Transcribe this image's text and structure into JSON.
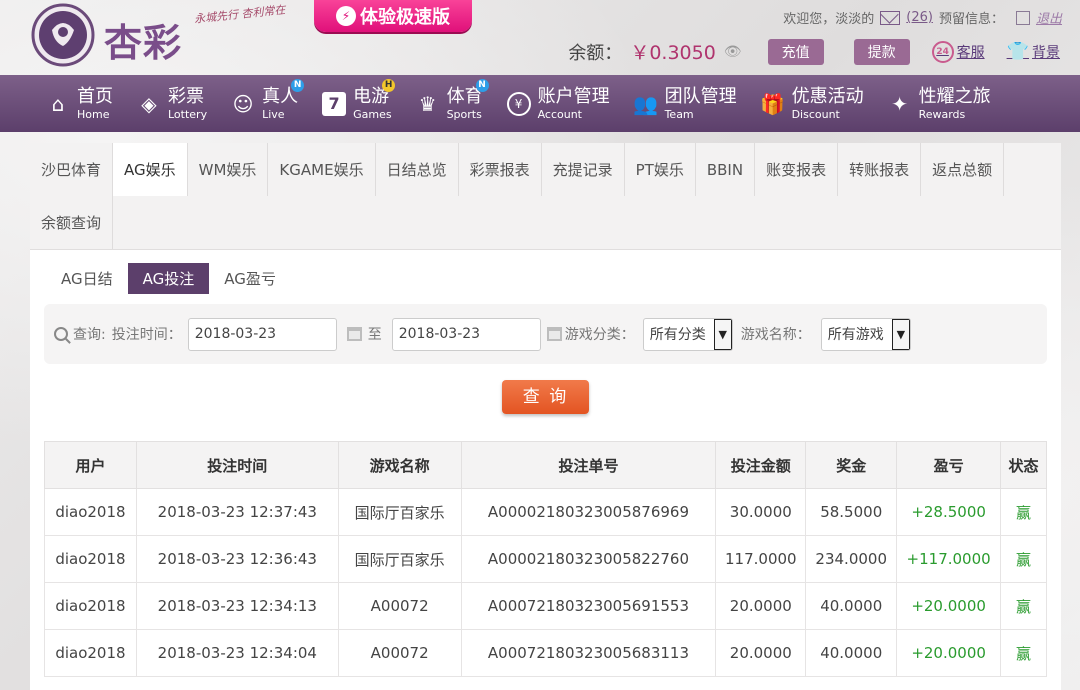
{
  "header": {
    "logo_text": "杏彩",
    "slogan": "永城先行 杏利常在",
    "promo_label": "体验极速版",
    "welcome": "欢迎您，",
    "username": "淡淡的",
    "mail_count": "(26)",
    "alert_label": "预留信息：",
    "logout_label": "退出",
    "balance_label": "余额：",
    "balance_value": "￥0.3050",
    "deposit_label": "充值",
    "withdraw_label": "提款",
    "service_label": "客服",
    "service_badge": "24",
    "theme_label": "背景"
  },
  "nav": [
    {
      "cn": "首页",
      "en": "Home",
      "icon": "home-icon",
      "badge": ""
    },
    {
      "cn": "彩票",
      "en": "Lottery",
      "icon": "ticket-icon",
      "badge": ""
    },
    {
      "cn": "真人",
      "en": "Live",
      "icon": "dealer-icon",
      "badge": "N"
    },
    {
      "cn": "电游",
      "en": "Games",
      "icon": "slot-seven-icon",
      "badge": "H"
    },
    {
      "cn": "体育",
      "en": "Sports",
      "icon": "trophy-icon",
      "badge": "N"
    },
    {
      "cn": "账户管理",
      "en": "Account",
      "icon": "yen-coin-icon",
      "badge": ""
    },
    {
      "cn": "团队管理",
      "en": "Team",
      "icon": "team-icon",
      "badge": ""
    },
    {
      "cn": "优惠活动",
      "en": "Discount",
      "icon": "gift-icon",
      "badge": ""
    },
    {
      "cn": "性耀之旅",
      "en": "Rewards",
      "icon": "rewards-icon",
      "badge": ""
    }
  ],
  "tabs": [
    "沙巴体育",
    "AG娱乐",
    "WM娱乐",
    "KGAME娱乐",
    "日结总览",
    "彩票报表",
    "充提记录",
    "PT娱乐",
    "BBIN",
    "账变报表",
    "转账报表",
    "返点总额",
    "余额查询"
  ],
  "active_tab": "AG娱乐",
  "subtabs": [
    "AG日结",
    "AG投注",
    "AG盈亏"
  ],
  "active_subtab": "AG投注",
  "filter": {
    "query_label": "查询:",
    "bet_time_label": "投注时间：",
    "date_from": "2018-03-23",
    "to_label": "至",
    "date_to": "2018-03-23",
    "category_label": "游戏分类：",
    "category_value": "所有分类",
    "game_name_label": "游戏名称：",
    "game_name_value": "所有游戏",
    "query_button": "查 询"
  },
  "table": {
    "headers": [
      "用户",
      "投注时间",
      "游戏名称",
      "投注单号",
      "投注金额",
      "奖金",
      "盈亏",
      "状态"
    ],
    "rows": [
      [
        "diao2018",
        "2018-03-23 12:37:43",
        "国际厅百家乐",
        "A00002180323005876969",
        "30.0000",
        "58.5000",
        "+28.5000",
        "赢"
      ],
      [
        "diao2018",
        "2018-03-23 12:36:43",
        "国际厅百家乐",
        "A00002180323005822760",
        "117.0000",
        "234.0000",
        "+117.0000",
        "赢"
      ],
      [
        "diao2018",
        "2018-03-23 12:34:13",
        "A00072",
        "A00072180323005691553",
        "20.0000",
        "40.0000",
        "+20.0000",
        "赢"
      ],
      [
        "diao2018",
        "2018-03-23 12:34:04",
        "A00072",
        "A00072180323005683113",
        "20.0000",
        "40.0000",
        "+20.0000",
        "赢"
      ]
    ]
  },
  "colors": {
    "nav_bg": "#5c3f6b",
    "accent_pink": "#b0346e",
    "win_green": "#2a9b2e",
    "query_orange": "#e35422"
  }
}
